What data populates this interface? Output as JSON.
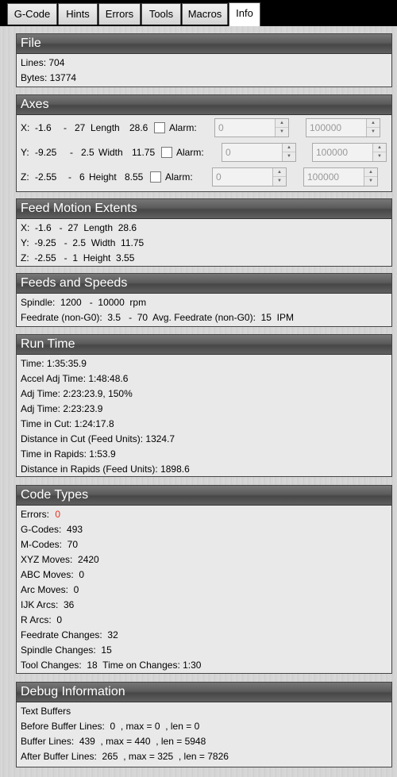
{
  "tabs": [
    {
      "label": "G-Code",
      "active": false
    },
    {
      "label": "Hints",
      "active": false
    },
    {
      "label": "Errors",
      "active": false
    },
    {
      "label": "Tools",
      "active": false
    },
    {
      "label": "Macros",
      "active": false
    },
    {
      "label": "Info",
      "active": true
    }
  ],
  "file": {
    "title": "File",
    "lines": "Lines: 704",
    "bytes": "Bytes: 13774"
  },
  "axes": {
    "title": "Axes",
    "alarm_label": "Alarm:",
    "rows": [
      {
        "axis": "X:",
        "min": "-1.6",
        "dash": "-",
        "max": "27",
        "dim_label": "Length",
        "dim": "28.6",
        "alarm_min": "0",
        "alarm_max": "100000"
      },
      {
        "axis": "Y:",
        "min": "-9.25",
        "dash": "-",
        "max": "2.5",
        "dim_label": "Width",
        "dim": "11.75",
        "alarm_min": "0",
        "alarm_max": "100000"
      },
      {
        "axis": "Z:",
        "min": "-2.55",
        "dash": "-",
        "max": "6",
        "dim_label": "Height",
        "dim": "8.55",
        "alarm_min": "0",
        "alarm_max": "100000"
      }
    ]
  },
  "feed_extents": {
    "title": "Feed Motion Extents",
    "rows": [
      "X:  -1.6   -  27  Length  28.6",
      "Y:  -9.25   -  2.5  Width  11.75",
      "Z:  -2.55   -  1  Height  3.55"
    ]
  },
  "feeds_speeds": {
    "title": "Feeds and Speeds",
    "spindle": "Spindle:  1200   -  10000  rpm",
    "feedrate": "Feedrate (non-G0):  3.5   -  70  Avg. Feedrate (non-G0):  15  IPM"
  },
  "run_time": {
    "title": "Run Time",
    "rows": [
      "Time: 1:35:35.9",
      "Accel Adj Time: 1:48:48.6",
      "Adj Time: 2:23:23.9, 150%",
      "Adj Time: 2:23:23.9",
      "Time in Cut: 1:24:17.8",
      "Distance in Cut (Feed Units): 1324.7",
      "Time in Rapids: 1:53.9",
      "Distance in Rapids (Feed Units): 1898.6"
    ]
  },
  "code_types": {
    "title": "Code Types",
    "errors_label": "Errors:",
    "errors_value": "0",
    "error_color": "#e8301c",
    "rows": [
      "G-Codes:  493",
      "M-Codes:  70",
      "XYZ Moves:  2420",
      "ABC Moves:  0",
      "Arc Moves:  0",
      "IJK Arcs:  36",
      "R Arcs:  0",
      "Feedrate Changes:  32",
      "Spindle Changes:  15",
      "Tool Changes:  18  Time on Changes: 1:30"
    ]
  },
  "debug": {
    "title": "Debug Information",
    "rows": [
      "Text Buffers",
      "Before Buffer Lines:  0  , max = 0  , len = 0",
      "Buffer Lines:  439  , max = 440  , len = 5948",
      "After Buffer Lines:  265  , max = 325  , len = 7826"
    ]
  }
}
